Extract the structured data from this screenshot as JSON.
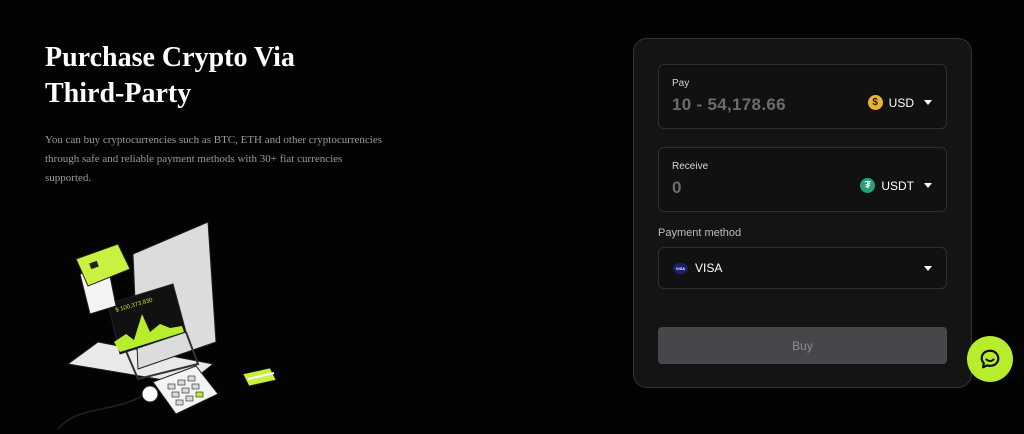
{
  "hero": {
    "title_line1": "Purchase Crypto Via",
    "title_line2": "Third-Party",
    "description": "You can buy cryptocurrencies such as BTC, ETH and other cryptocurrencies through safe and reliable payment methods with 30+ fiat currencies supported.",
    "illustration_screen_text": "$ 100,373.830"
  },
  "form": {
    "pay": {
      "label": "Pay",
      "value": "10 - 54,178.66",
      "currency": "USD",
      "icon": "dollar-coin-icon"
    },
    "receive": {
      "label": "Receive",
      "value": "0",
      "currency": "USDT",
      "icon": "tether-coin-icon"
    },
    "payment_method": {
      "label": "Payment method",
      "selected": "VISA",
      "icon": "visa-icon"
    },
    "buy_label": "Buy"
  },
  "colors": {
    "accent": "#b7ed2c",
    "background": "#030303",
    "panel": "#141414",
    "usd_coin": "#e9b531",
    "usdt_coin": "#26a17b"
  },
  "chat": {
    "icon": "chat-bubble-icon"
  }
}
